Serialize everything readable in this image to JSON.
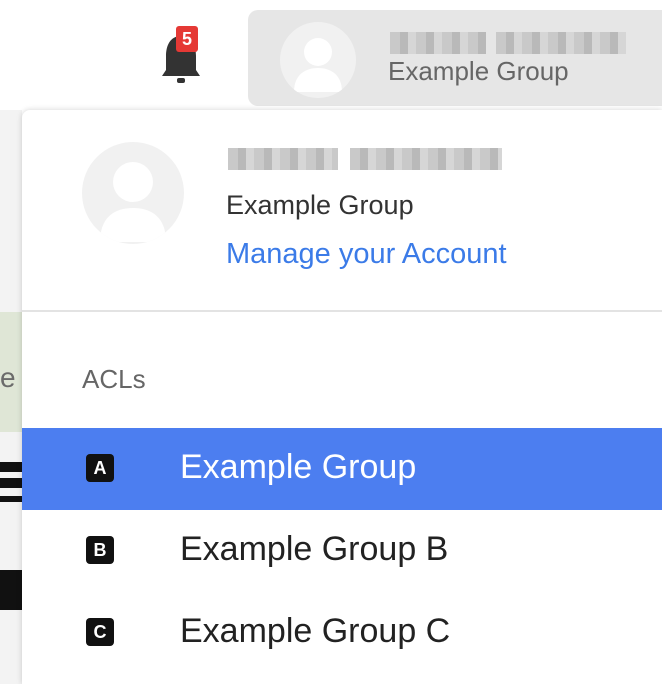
{
  "header": {
    "notifications": {
      "count": "5",
      "icon": "bell-icon"
    },
    "user_chip": {
      "group": "Example Group",
      "name_redacted": true
    }
  },
  "dropdown": {
    "user": {
      "group": "Example Group",
      "name_redacted": true
    },
    "manage_account_label": "Manage your Account",
    "section_title": "ACLs",
    "acls": [
      {
        "icon_letter": "A",
        "label": "Example Group",
        "selected": true
      },
      {
        "icon_letter": "B",
        "label": "Example Group B",
        "selected": false
      },
      {
        "icon_letter": "C",
        "label": "Example Group C",
        "selected": false
      }
    ]
  },
  "background": {
    "partial_letter": "e"
  },
  "colors": {
    "accent": "#4c7ef0",
    "link": "#3b7be8",
    "badge": "#e53935"
  }
}
